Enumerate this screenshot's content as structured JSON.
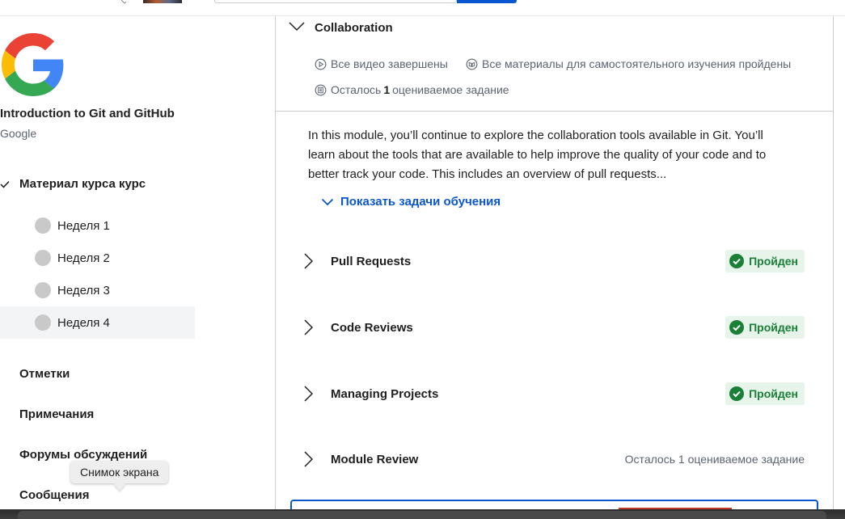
{
  "course": {
    "title": "Introduction to Git and GitHub",
    "org": "Google"
  },
  "sidebar": {
    "material_label": "Материал курса курс",
    "weeks": [
      {
        "label": "Неделя 1"
      },
      {
        "label": "Неделя 2"
      },
      {
        "label": "Неделя 3"
      },
      {
        "label": "Неделя 4",
        "active": true
      }
    ],
    "links": [
      {
        "label": "Отметки"
      },
      {
        "label": "Примечания"
      },
      {
        "label": "Форумы обсуждений"
      },
      {
        "label": "Сообщения"
      }
    ]
  },
  "tooltip": {
    "text": "Снимок экрана"
  },
  "module": {
    "title": "Collaboration",
    "stats": {
      "videos": "Все видео завершены",
      "materials": "Все материалы для самостоятельного изучения пройдены",
      "remaining_prefix": "Осталось",
      "remaining_count": "1",
      "remaining_suffix": "оцениваемое задание"
    },
    "description": "In this module, you’ll continue to explore the collaboration tools available in Git. You’ll learn about the tools that are available to help improve the quality of your code and to better track your code. This includes an overview of pull requests...",
    "show_goals": "Показать задачи обучения",
    "lessons": [
      {
        "title": "Pull Requests",
        "status": "Пройден"
      },
      {
        "title": "Code Reviews",
        "status": "Пройден"
      },
      {
        "title": "Managing Projects",
        "status": "Пройден"
      },
      {
        "title": "Module Review",
        "status": "Осталось 1 оцениваемое задание"
      }
    ]
  },
  "colors": {
    "accent": "#0a56d0",
    "success_bg": "#e6f4ea",
    "success_text": "#1a7f37"
  }
}
